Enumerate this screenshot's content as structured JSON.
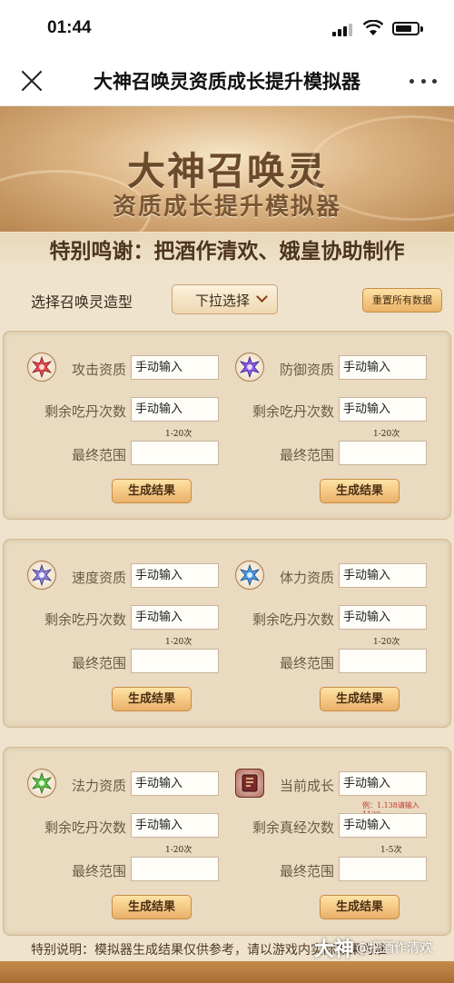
{
  "status": {
    "time": "01:44"
  },
  "nav": {
    "title": "大神召唤灵资质成长提升模拟器",
    "close_icon": "close-icon",
    "more_icon": "more-icon"
  },
  "banner": {
    "title1": "大神召唤灵",
    "title2": "资质成长提升模拟器"
  },
  "thanks": "特别鸣谢：把酒作清欢、娥皇协助制作",
  "selector": {
    "label": "选择召唤灵造型",
    "dropdown": "下拉选择",
    "reset": "重置所有数据"
  },
  "panels": [
    {
      "left": {
        "gem_icon": "attack-gem-icon",
        "stat": "攻击资质",
        "stat_value": "手动输入",
        "count_label": "剩余吃丹次数",
        "count_value": "手动输入",
        "hint": "1-20次",
        "range_label": "最终范围",
        "range_value": "",
        "button": "生成结果"
      },
      "right": {
        "gem_icon": "defense-gem-icon",
        "stat": "防御资质",
        "stat_value": "手动输入",
        "count_label": "剩余吃丹次数",
        "count_value": "手动输入",
        "hint": "1-20次",
        "range_label": "最终范围",
        "range_value": "",
        "button": "生成结果"
      }
    },
    {
      "left": {
        "gem_icon": "speed-gem-icon",
        "stat": "速度资质",
        "stat_value": "手动输入",
        "count_label": "剩余吃丹次数",
        "count_value": "手动输入",
        "hint": "1-20次",
        "range_label": "最终范围",
        "range_value": "",
        "button": "生成结果"
      },
      "right": {
        "gem_icon": "stamina-gem-icon",
        "stat": "体力资质",
        "stat_value": "手动输入",
        "count_label": "剩余吃丹次数",
        "count_value": "手动输入",
        "hint": "1-20次",
        "range_label": "最终范围",
        "range_value": "",
        "button": "生成结果"
      }
    },
    {
      "left": {
        "gem_icon": "magic-gem-icon",
        "stat": "法力资质",
        "stat_value": "手动输入",
        "count_label": "剩余吃丹次数",
        "count_value": "手动输入",
        "hint": "1-20次",
        "range_label": "最终范围",
        "range_value": "",
        "button": "生成结果"
      },
      "right": {
        "gem_icon": "growth-scroll-icon",
        "stat": "当前成长",
        "stat_value": "手动输入",
        "example": "例：1.138请输入1138",
        "count_label": "剩余真经次数",
        "count_value": "手动输入",
        "hint": "1-5次",
        "range_label": "最终范围",
        "range_value": "",
        "button": "生成结果"
      }
    }
  ],
  "footnote": "特别说明：模拟器生成结果仅供参考，请以游戏内实际效果为准",
  "watermark": {
    "brand": "大神",
    "author": "@把酒作清欢"
  },
  "colors": {
    "gem_attack": "#e04a4a",
    "gem_defense": "#8a5ae0",
    "gem_speed": "#8a7fd6",
    "gem_stamina": "#4a9ae0",
    "gem_magic": "#59c24a",
    "accent": "#eab06a"
  }
}
